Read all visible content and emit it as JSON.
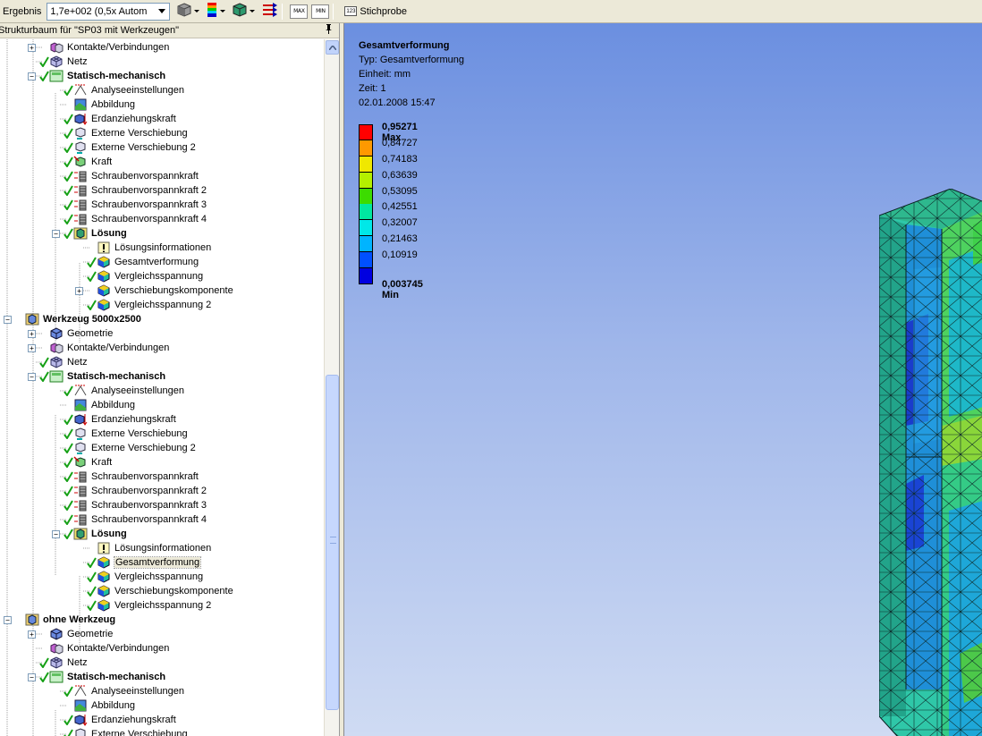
{
  "toolbar": {
    "result_label": "Ergebnis",
    "scale_value": "1,7e+002 (0,5x Autom",
    "max_label": "MAX",
    "min_label": "MIN",
    "probe_icon": "123",
    "probe_label": "Stichprobe"
  },
  "tree": {
    "header": "Strukturbaum für \"SP03 mit Werkzeugen\"",
    "rows": [
      {
        "text": "Kontakte/Verbindungen",
        "level": 2,
        "expander": "+",
        "check": false,
        "icon": "contacts-icon",
        "bold": false
      },
      {
        "text": "Netz",
        "level": 2,
        "expander": "",
        "check": true,
        "icon": "mesh-icon",
        "bold": false
      },
      {
        "text": "Statisch-mechanisch",
        "level": 2,
        "expander": "-",
        "check": true,
        "icon": "static-structural-icon",
        "bold": true
      },
      {
        "text": "Analyseeinstellungen",
        "level": 3,
        "expander": "",
        "check": true,
        "icon": "analysis-settings-icon",
        "bold": false
      },
      {
        "text": "Abbildung",
        "level": 3,
        "expander": "",
        "check": false,
        "icon": "figure-icon",
        "bold": false
      },
      {
        "text": "Erdanziehungskraft",
        "level": 3,
        "expander": "",
        "check": true,
        "icon": "gravity-icon",
        "bold": false
      },
      {
        "text": "Externe Verschiebung",
        "level": 3,
        "expander": "",
        "check": true,
        "icon": "displacement-icon",
        "bold": false
      },
      {
        "text": "Externe Verschiebung 2",
        "level": 3,
        "expander": "",
        "check": true,
        "icon": "displacement-icon",
        "bold": false
      },
      {
        "text": "Kraft",
        "level": 3,
        "expander": "",
        "check": true,
        "icon": "force-icon",
        "bold": false
      },
      {
        "text": "Schraubenvorspannkraft",
        "level": 3,
        "expander": "",
        "check": true,
        "icon": "bolt-pretension-icon",
        "bold": false
      },
      {
        "text": "Schraubenvorspannkraft 2",
        "level": 3,
        "expander": "",
        "check": true,
        "icon": "bolt-pretension-icon",
        "bold": false
      },
      {
        "text": "Schraubenvorspannkraft 3",
        "level": 3,
        "expander": "",
        "check": true,
        "icon": "bolt-pretension-icon",
        "bold": false
      },
      {
        "text": "Schraubenvorspannkraft 4",
        "level": 3,
        "expander": "",
        "check": true,
        "icon": "bolt-pretension-icon",
        "bold": false
      },
      {
        "text": "Lösung",
        "level": 3,
        "expander": "-",
        "check": true,
        "icon": "solution-icon",
        "bold": true
      },
      {
        "text": "Lösungsinformationen",
        "level": 4,
        "expander": "",
        "check": false,
        "icon": "solution-info-icon",
        "bold": false
      },
      {
        "text": "Gesamtverformung",
        "level": 4,
        "expander": "",
        "check": true,
        "icon": "result-icon",
        "bold": false
      },
      {
        "text": "Vergleichsspannung",
        "level": 4,
        "expander": "",
        "check": true,
        "icon": "result-icon",
        "bold": false
      },
      {
        "text": "Verschiebungskomponente",
        "level": 4,
        "expander": "+",
        "check": false,
        "icon": "result-icon",
        "bold": false
      },
      {
        "text": "Vergleichsspannung 2",
        "level": 4,
        "expander": "",
        "check": true,
        "icon": "result-icon",
        "bold": false
      },
      {
        "text": "Werkzeug 5000x2500",
        "level": 0,
        "expander": "-",
        "check": false,
        "icon": "model-icon",
        "bold": true
      },
      {
        "text": "Geometrie",
        "level": 2,
        "expander": "+",
        "check": false,
        "icon": "geometry-icon",
        "bold": false
      },
      {
        "text": "Kontakte/Verbindungen",
        "level": 2,
        "expander": "+",
        "check": false,
        "icon": "contacts-icon",
        "bold": false
      },
      {
        "text": "Netz",
        "level": 2,
        "expander": "",
        "check": true,
        "icon": "mesh-icon",
        "bold": false
      },
      {
        "text": "Statisch-mechanisch",
        "level": 2,
        "expander": "-",
        "check": true,
        "icon": "static-structural-icon",
        "bold": true
      },
      {
        "text": "Analyseeinstellungen",
        "level": 3,
        "expander": "",
        "check": true,
        "icon": "analysis-settings-icon",
        "bold": false
      },
      {
        "text": "Abbildung",
        "level": 3,
        "expander": "",
        "check": false,
        "icon": "figure-icon",
        "bold": false
      },
      {
        "text": "Erdanziehungskraft",
        "level": 3,
        "expander": "",
        "check": true,
        "icon": "gravity-icon",
        "bold": false
      },
      {
        "text": "Externe Verschiebung",
        "level": 3,
        "expander": "",
        "check": true,
        "icon": "displacement-icon",
        "bold": false
      },
      {
        "text": "Externe Verschiebung 2",
        "level": 3,
        "expander": "",
        "check": true,
        "icon": "displacement-icon",
        "bold": false
      },
      {
        "text": "Kraft",
        "level": 3,
        "expander": "",
        "check": true,
        "icon": "force-icon",
        "bold": false
      },
      {
        "text": "Schraubenvorspannkraft",
        "level": 3,
        "expander": "",
        "check": true,
        "icon": "bolt-pretension-icon",
        "bold": false
      },
      {
        "text": "Schraubenvorspannkraft 2",
        "level": 3,
        "expander": "",
        "check": true,
        "icon": "bolt-pretension-icon",
        "bold": false
      },
      {
        "text": "Schraubenvorspannkraft 3",
        "level": 3,
        "expander": "",
        "check": true,
        "icon": "bolt-pretension-icon",
        "bold": false
      },
      {
        "text": "Schraubenvorspannkraft 4",
        "level": 3,
        "expander": "",
        "check": true,
        "icon": "bolt-pretension-icon",
        "bold": false
      },
      {
        "text": "Lösung",
        "level": 3,
        "expander": "-",
        "check": true,
        "icon": "solution-icon",
        "bold": true
      },
      {
        "text": "Lösungsinformationen",
        "level": 4,
        "expander": "",
        "check": false,
        "icon": "solution-info-icon",
        "bold": false
      },
      {
        "text": "Gesamtverformung",
        "level": 4,
        "expander": "",
        "check": true,
        "icon": "result-icon",
        "bold": false,
        "selected": true
      },
      {
        "text": "Vergleichsspannung",
        "level": 4,
        "expander": "",
        "check": true,
        "icon": "result-icon",
        "bold": false
      },
      {
        "text": "Verschiebungskomponente",
        "level": 4,
        "expander": "",
        "check": true,
        "icon": "result-icon",
        "bold": false
      },
      {
        "text": "Vergleichsspannung 2",
        "level": 4,
        "expander": "",
        "check": true,
        "icon": "result-icon",
        "bold": false
      },
      {
        "text": "ohne Werkzeug",
        "level": 0,
        "expander": "-",
        "check": false,
        "icon": "model-icon",
        "bold": true
      },
      {
        "text": "Geometrie",
        "level": 2,
        "expander": "+",
        "check": false,
        "icon": "geometry-icon",
        "bold": false
      },
      {
        "text": "Kontakte/Verbindungen",
        "level": 2,
        "expander": "",
        "check": false,
        "icon": "contacts-icon",
        "bold": false
      },
      {
        "text": "Netz",
        "level": 2,
        "expander": "",
        "check": true,
        "icon": "mesh-icon",
        "bold": false
      },
      {
        "text": "Statisch-mechanisch",
        "level": 2,
        "expander": "-",
        "check": true,
        "icon": "static-structural-icon",
        "bold": true
      },
      {
        "text": "Analyseeinstellungen",
        "level": 3,
        "expander": "",
        "check": true,
        "icon": "analysis-settings-icon",
        "bold": false
      },
      {
        "text": "Abbildung",
        "level": 3,
        "expander": "",
        "check": false,
        "icon": "figure-icon",
        "bold": false
      },
      {
        "text": "Erdanziehungskraft",
        "level": 3,
        "expander": "",
        "check": true,
        "icon": "gravity-icon",
        "bold": false
      },
      {
        "text": "Externe Verschiebung",
        "level": 3,
        "expander": "",
        "check": true,
        "icon": "displacement-icon",
        "bold": false
      }
    ]
  },
  "viewport": {
    "title": "Gesamtverformung",
    "type_line": "Typ: Gesamtverformung",
    "unit_line": "Einheit: mm",
    "time_line": "Zeit: 1",
    "date_line": "02.01.2008 15:47"
  },
  "legend": {
    "labels": [
      "0,95271 Max",
      "0,84727",
      "0,74183",
      "0,63639",
      "0,53095",
      "0,42551",
      "0,32007",
      "0,21463",
      "0,10919",
      "0,003745 Min"
    ],
    "colors": [
      "#ff0000",
      "#ff9900",
      "#f0e800",
      "#b4f000",
      "#3cdc00",
      "#00e8a0",
      "#00e8e8",
      "#00b4ff",
      "#0050ff",
      "#0000e0"
    ]
  }
}
